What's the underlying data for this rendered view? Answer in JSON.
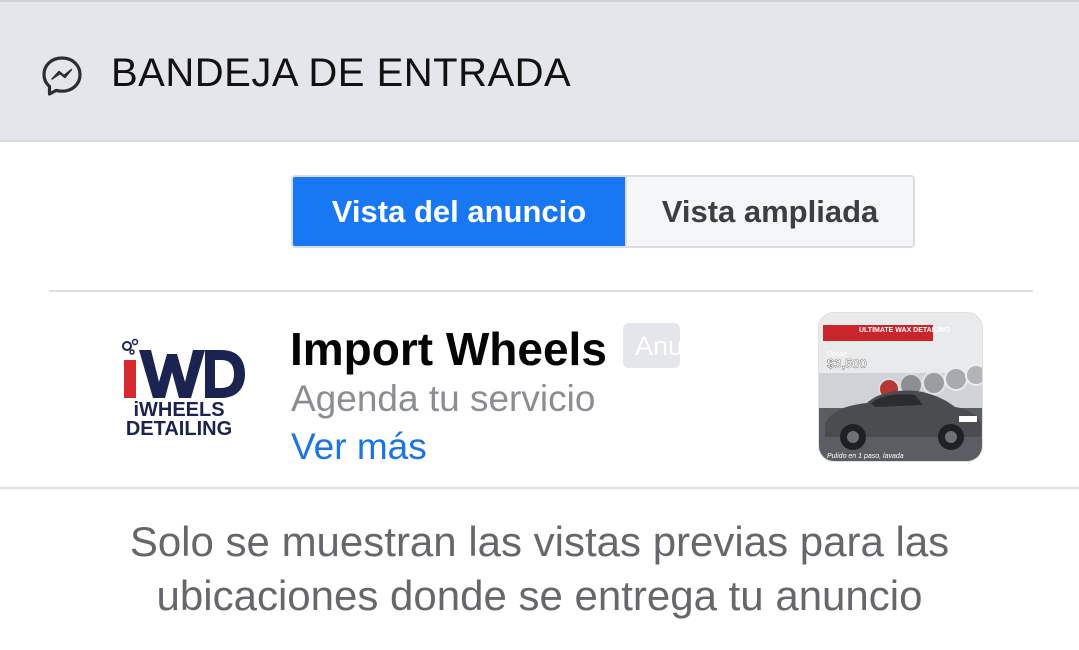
{
  "header": {
    "icon": "messenger-icon",
    "title": "BANDEJA DE ENTRADA"
  },
  "view_toggle": {
    "active_label": "Vista del anuncio",
    "inactive_label": "Vista ampliada"
  },
  "ad": {
    "logo": {
      "line1": "iWHEELS",
      "line2": "DETAILING"
    },
    "name": "Import Wheels",
    "badge": "Anuncio",
    "description": "Agenda tu servicio",
    "link": "Ver más",
    "thumbnail": {
      "banner": "ULTIMATE WAX DETAILING",
      "price_prefix": "Desde",
      "price": "$3,500",
      "caption": "Pulido en 1 paso, lavada"
    }
  },
  "footer": {
    "line1": "Solo se muestran las vistas previas para las",
    "line2": "ubicaciones donde se entrega tu anuncio"
  },
  "colors": {
    "accent": "#1877f2",
    "link": "#1b74e4",
    "header_bg": "#e4e6eb"
  }
}
